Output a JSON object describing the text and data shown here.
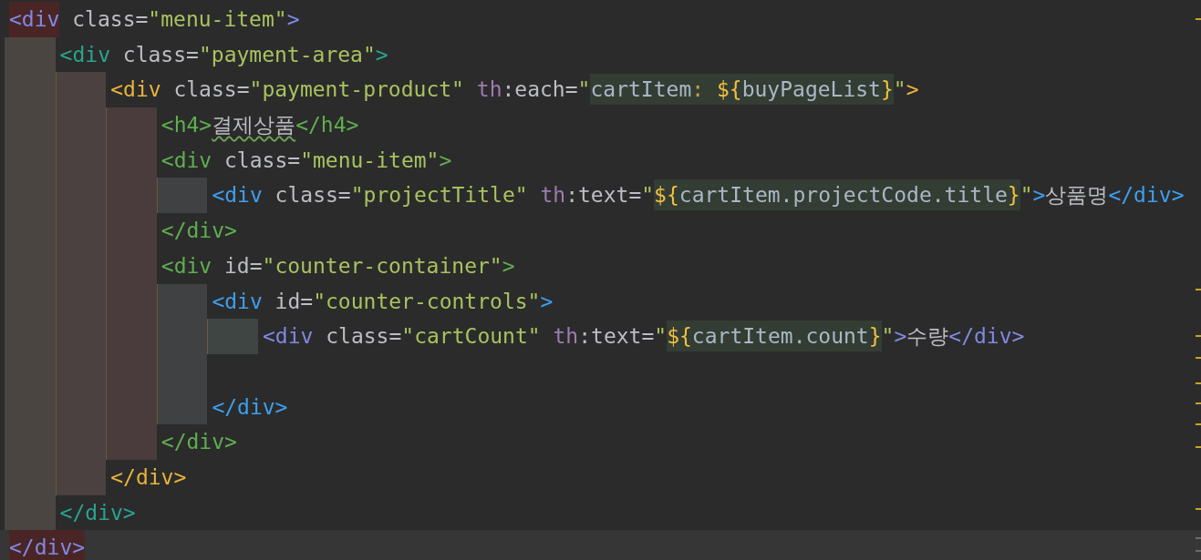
{
  "lines": [
    {
      "kind": "code",
      "current": false,
      "color": "#4a4541",
      "tokens": [
        {
          "kind": "tag",
          "text": "<div",
          "color": "#7f89e3",
          "matched": true
        },
        {
          "kind": "attr",
          "text": " class"
        },
        {
          "kind": "punct",
          "text": "="
        },
        {
          "kind": "value",
          "text": "\"menu-item\""
        },
        {
          "kind": "tag",
          "text": ">",
          "color": "#7f89e3",
          "matched": false
        }
      ],
      "children": [
        {
          "kind": "code",
          "current": false,
          "color": "#4b4141",
          "tokens": [
            {
              "kind": "tag",
              "text": "<div",
              "color": "#2aa38f",
              "matched": false
            },
            {
              "kind": "attr",
              "text": " class"
            },
            {
              "kind": "punct",
              "text": "="
            },
            {
              "kind": "value",
              "text": "\"payment-area\""
            },
            {
              "kind": "tag",
              "text": ">",
              "color": "#2aa38f",
              "matched": false
            }
          ],
          "children": [
            {
              "kind": "code",
              "current": false,
              "color": "#4a3c3c",
              "tokens": [
                {
                  "kind": "tag",
                  "text": "<div",
                  "color": "#e8b33c",
                  "matched": false
                },
                {
                  "kind": "attr",
                  "text": " class"
                },
                {
                  "kind": "punct",
                  "text": "="
                },
                {
                  "kind": "value",
                  "text": "\"payment-product\""
                },
                {
                  "kind": "ns",
                  "text": " th"
                },
                {
                  "kind": "attr",
                  "text": ":each"
                },
                {
                  "kind": "punct",
                  "text": "="
                },
                {
                  "kind": "value",
                  "text": "\""
                },
                {
                  "kind": "fragment",
                  "parts": [
                    {
                      "kind": "ident",
                      "text": "cartItem"
                    },
                    {
                      "kind": "op",
                      "text": ": "
                    },
                    {
                      "kind": "brace",
                      "text": "${"
                    },
                    {
                      "kind": "ident",
                      "text": "buyPageList"
                    },
                    {
                      "kind": "brace",
                      "text": "}"
                    }
                  ]
                },
                {
                  "kind": "value",
                  "text": "\""
                },
                {
                  "kind": "tag",
                  "text": ">",
                  "color": "#e8b33c",
                  "matched": false
                }
              ],
              "children": [
                {
                  "kind": "code",
                  "current": false,
                  "tokens": [
                    {
                      "kind": "tag",
                      "text": "<h4>",
                      "color": "#5fae4f",
                      "matched": false
                    },
                    {
                      "kind": "text",
                      "text": "결제상품",
                      "typo": true
                    },
                    {
                      "kind": "tag",
                      "text": "</h4>",
                      "color": "#5fae4f",
                      "matched": false
                    }
                  ]
                },
                {
                  "kind": "code",
                  "current": false,
                  "color": "#3f4143",
                  "tokens": [
                    {
                      "kind": "tag",
                      "text": "<div",
                      "color": "#5fae4f",
                      "matched": false
                    },
                    {
                      "kind": "attr",
                      "text": " class"
                    },
                    {
                      "kind": "punct",
                      "text": "="
                    },
                    {
                      "kind": "value",
                      "text": "\"menu-item\""
                    },
                    {
                      "kind": "tag",
                      "text": ">",
                      "color": "#5fae4f",
                      "matched": false
                    }
                  ],
                  "children": [
                    {
                      "kind": "code",
                      "current": false,
                      "tokens": [
                        {
                          "kind": "tag",
                          "text": "<div",
                          "color": "#3d9ff0",
                          "matched": false
                        },
                        {
                          "kind": "attr",
                          "text": " class"
                        },
                        {
                          "kind": "punct",
                          "text": "="
                        },
                        {
                          "kind": "value",
                          "text": "\"projectTitle\""
                        },
                        {
                          "kind": "ns",
                          "text": " th"
                        },
                        {
                          "kind": "attr",
                          "text": ":text"
                        },
                        {
                          "kind": "punct",
                          "text": "="
                        },
                        {
                          "kind": "value",
                          "text": "\""
                        },
                        {
                          "kind": "fragment",
                          "parts": [
                            {
                              "kind": "brace",
                              "text": "${"
                            },
                            {
                              "kind": "ident",
                              "text": "cartItem.projectCode.title"
                            },
                            {
                              "kind": "brace",
                              "text": "}"
                            }
                          ]
                        },
                        {
                          "kind": "value",
                          "text": "\""
                        },
                        {
                          "kind": "tag",
                          "text": ">",
                          "color": "#3d9ff0",
                          "matched": false
                        },
                        {
                          "kind": "text",
                          "text": "상품명",
                          "typo": false
                        },
                        {
                          "kind": "tag",
                          "text": "</div>",
                          "color": "#3d9ff0",
                          "matched": false
                        }
                      ]
                    }
                  ]
                },
                {
                  "kind": "code",
                  "current": false,
                  "tokens": [
                    {
                      "kind": "tag",
                      "text": "</div>",
                      "color": "#5fae4f",
                      "matched": false
                    }
                  ]
                },
                {
                  "kind": "code",
                  "current": false,
                  "color": "#3f4143",
                  "tokens": [
                    {
                      "kind": "tag",
                      "text": "<div",
                      "color": "#5fae4f",
                      "matched": false
                    },
                    {
                      "kind": "attr",
                      "text": " id"
                    },
                    {
                      "kind": "punct",
                      "text": "="
                    },
                    {
                      "kind": "value",
                      "text": "\"counter-container\""
                    },
                    {
                      "kind": "tag",
                      "text": ">",
                      "color": "#5fae4f",
                      "matched": false
                    }
                  ],
                  "children": [
                    {
                      "kind": "code",
                      "current": false,
                      "color": "#3e4542",
                      "tokens": [
                        {
                          "kind": "tag",
                          "text": "<div",
                          "color": "#3d9ff0",
                          "matched": false
                        },
                        {
                          "kind": "attr",
                          "text": " id"
                        },
                        {
                          "kind": "punct",
                          "text": "="
                        },
                        {
                          "kind": "value",
                          "text": "\"counter-controls\""
                        },
                        {
                          "kind": "tag",
                          "text": ">",
                          "color": "#3d9ff0",
                          "matched": false
                        }
                      ],
                      "children": [
                        {
                          "kind": "code",
                          "current": false,
                          "tokens": [
                            {
                              "kind": "tag",
                              "text": "<div",
                              "color": "#7f89e3",
                              "matched": false
                            },
                            {
                              "kind": "attr",
                              "text": " class"
                            },
                            {
                              "kind": "punct",
                              "text": "="
                            },
                            {
                              "kind": "value",
                              "text": "\"cartCount\""
                            },
                            {
                              "kind": "ns",
                              "text": " th"
                            },
                            {
                              "kind": "attr",
                              "text": ":text"
                            },
                            {
                              "kind": "punct",
                              "text": "="
                            },
                            {
                              "kind": "value",
                              "text": "\""
                            },
                            {
                              "kind": "fragment",
                              "parts": [
                                {
                                  "kind": "brace",
                                  "text": "${"
                                },
                                {
                                  "kind": "ident",
                                  "text": "cartItem.count"
                                },
                                {
                                  "kind": "brace",
                                  "text": "}"
                                }
                              ]
                            },
                            {
                              "kind": "value",
                              "text": "\""
                            },
                            {
                              "kind": "tag",
                              "text": ">",
                              "color": "#7f89e3",
                              "matched": false
                            },
                            {
                              "kind": "text",
                              "text": "수량",
                              "typo": false
                            },
                            {
                              "kind": "tag",
                              "text": "</div>",
                              "color": "#7f89e3",
                              "matched": false
                            }
                          ]
                        }
                      ]
                    },
                    {
                      "kind": "blank",
                      "current": false
                    },
                    {
                      "kind": "code",
                      "current": false,
                      "tokens": [
                        {
                          "kind": "tag",
                          "text": "</div>",
                          "color": "#3d9ff0",
                          "matched": false
                        }
                      ]
                    }
                  ]
                },
                {
                  "kind": "code",
                  "current": false,
                  "tokens": [
                    {
                      "kind": "tag",
                      "text": "</div>",
                      "color": "#5fae4f",
                      "matched": false
                    }
                  ]
                }
              ]
            },
            {
              "kind": "code",
              "current": false,
              "tokens": [
                {
                  "kind": "tag",
                  "text": "</div>",
                  "color": "#e8b33c",
                  "matched": false
                }
              ]
            }
          ]
        },
        {
          "kind": "code",
          "current": false,
          "tokens": [
            {
              "kind": "tag",
              "text": "</div>",
              "color": "#2aa38f",
              "matched": false
            }
          ]
        }
      ]
    },
    {
      "kind": "code",
      "current": true,
      "tokens": [
        {
          "kind": "tag",
          "text": "</div>",
          "color": "#7f89e3",
          "matched": true
        }
      ]
    }
  ]
}
